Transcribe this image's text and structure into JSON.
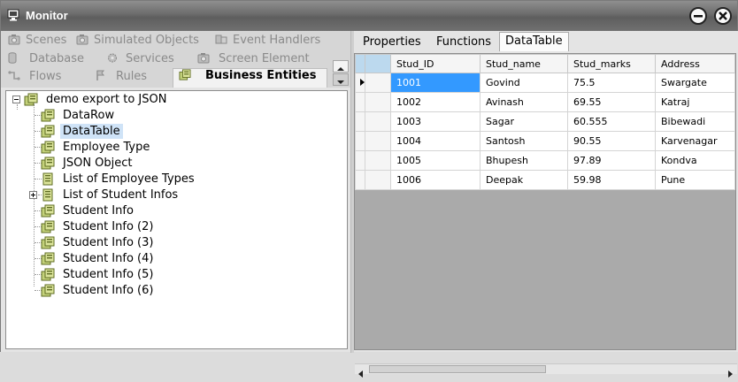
{
  "window": {
    "title": "Monitor"
  },
  "left_tabs": {
    "row1": [
      {
        "label": "Scenes",
        "icon": "camera-icon"
      },
      {
        "label": "Simulated Objects",
        "icon": "camera-icon"
      },
      {
        "label": "Event Handlers",
        "icon": "event-icon"
      }
    ],
    "row2": [
      {
        "label": "Database",
        "icon": "database-icon"
      },
      {
        "label": "Services",
        "icon": "gear-icon"
      },
      {
        "label": "Screen Element",
        "icon": "camera-icon"
      }
    ],
    "row3": [
      {
        "label": "Flows",
        "icon": "flow-icon"
      },
      {
        "label": "Rules",
        "icon": "flag-icon"
      },
      {
        "label": "Business Entities",
        "icon": "entity-icon",
        "active": true
      }
    ]
  },
  "tree": {
    "root": "demo export to JSON",
    "children": [
      {
        "label": "DataRow"
      },
      {
        "label": "DataTable",
        "selected": true
      },
      {
        "label": "Employee Type"
      },
      {
        "label": "JSON Object"
      },
      {
        "label": "List of Employee Types"
      },
      {
        "label": "List of Student Infos",
        "expandable": true
      },
      {
        "label": "Student Info"
      },
      {
        "label": "Student Info (2)"
      },
      {
        "label": "Student Info (3)"
      },
      {
        "label": "Student Info (4)"
      },
      {
        "label": "Student Info (5)"
      },
      {
        "label": "Student Info (6)"
      }
    ]
  },
  "right_tabs": [
    {
      "label": "Properties"
    },
    {
      "label": "Functions"
    },
    {
      "label": "DataTable",
      "active": true
    }
  ],
  "grid": {
    "columns": [
      "Stud_ID",
      "Stud_name",
      "Stud_marks",
      "Address"
    ],
    "rows": [
      [
        "1001",
        "Govind",
        "75.5",
        "Swargate"
      ],
      [
        "1002",
        "Avinash",
        "69.55",
        "Katraj"
      ],
      [
        "1003",
        "Sagar",
        "60.555",
        "Bibewadi"
      ],
      [
        "1004",
        "Santosh",
        "90.55",
        "Karvenagar"
      ],
      [
        "1005",
        "Bhupesh",
        "97.89",
        "Kondva"
      ],
      [
        "1006",
        "Deepak",
        "59.98",
        "Pune"
      ]
    ]
  },
  "colors": {
    "selection": "#3399ff",
    "tree_selection": "#cfe3f7",
    "title_bar": "#6b6b6b",
    "entity_icon": "#b8c878"
  }
}
